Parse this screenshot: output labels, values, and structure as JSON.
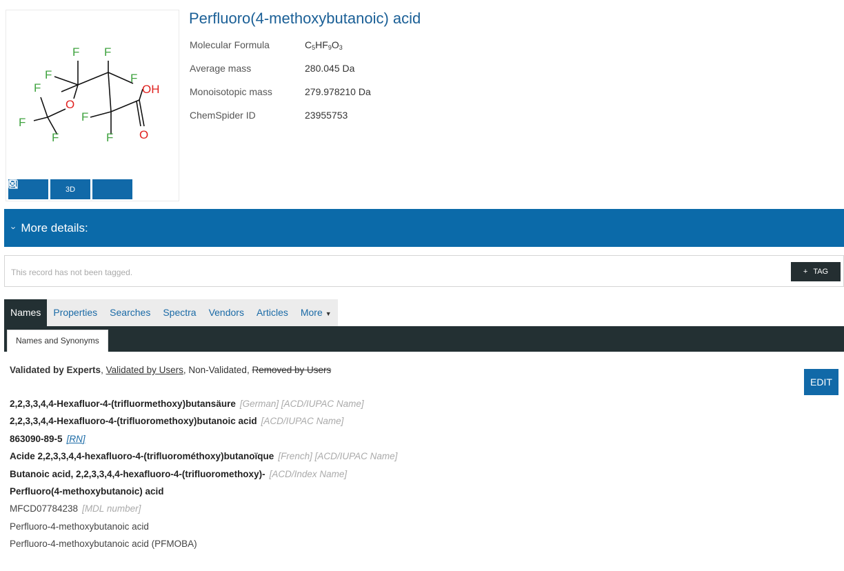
{
  "compound": {
    "title": "Perfluoro(4-methoxybutanoic) acid",
    "properties": [
      {
        "label": "Molecular Formula",
        "parts": [
          {
            "t": "C"
          },
          {
            "t": "5",
            "sub": true
          },
          {
            "t": "HF"
          },
          {
            "t": "9",
            "sub": true
          },
          {
            "t": "O"
          },
          {
            "t": "3",
            "sub": true
          }
        ]
      },
      {
        "label": "Average mass",
        "value": "280.045 Da"
      },
      {
        "label": "Monoisotopic mass",
        "value": "279.978210 Da"
      },
      {
        "label": "ChemSpider ID",
        "value": "23955753"
      }
    ]
  },
  "structure": {
    "atoms": [
      "F",
      "F",
      "F",
      "F",
      "F",
      "OH",
      "F",
      "O",
      "F",
      "F",
      "F",
      "O"
    ],
    "colors": {
      "fluorine": "#3fa33f",
      "oxygen": "#e0201e",
      "bond": "#111111"
    }
  },
  "image_toolbar": {
    "save_icon": "save-icon",
    "three_d_label": "3D",
    "zoom_icon": "zoom-in-icon"
  },
  "details": {
    "label": "More details:"
  },
  "tags": {
    "empty_text": "This record has not been tagged.",
    "button_plus": "+",
    "button_label": "TAG"
  },
  "tabs": [
    {
      "label": "Names",
      "active": true
    },
    {
      "label": "Properties"
    },
    {
      "label": "Searches"
    },
    {
      "label": "Spectra"
    },
    {
      "label": "Vendors"
    },
    {
      "label": "Articles"
    },
    {
      "label": "More"
    }
  ],
  "subtab": {
    "label": "Names and Synonyms"
  },
  "legend": {
    "experts": "Validated by Experts",
    "sep1": ", ",
    "users": "Validated by Users",
    "sep2": ", Non-Validated, ",
    "removed": "Removed by Users"
  },
  "edit_label": "EDIT",
  "names": [
    {
      "name": "2,2,3,3,4,4-Hexafluor-4-(trifluormethoxy)butansäure",
      "ref": "[German] [ACD/IUPAC Name]",
      "bold": true
    },
    {
      "name": "2,2,3,3,4,4-Hexafluoro-4-(trifluoromethoxy)butanoic acid",
      "ref": "[ACD/IUPAC Name]",
      "bold": true
    },
    {
      "name": "863090-89-5",
      "ref": "[RN]",
      "bold": true,
      "link": true
    },
    {
      "name": "Acide 2,2,3,3,4,4-hexafluoro-4-(trifluorométhoxy)butanoïque",
      "ref": "[French] [ACD/IUPAC Name]",
      "bold": true
    },
    {
      "name": "Butanoic acid, 2,2,3,3,4,4-hexafluoro-4-(trifluoromethoxy)-",
      "ref": "[ACD/Index Name]",
      "bold": true
    },
    {
      "name": "Perfluoro(4-methoxybutanoic) acid",
      "ref": "",
      "bold": true
    },
    {
      "name": "MFCD07784238",
      "ref": "[MDL number]",
      "bold": false
    },
    {
      "name": "Perfluoro-4-methoxybutanoic acid",
      "ref": "",
      "bold": false
    },
    {
      "name": "Perfluoro-4-methoxybutanoic acid (PFMOBA)",
      "ref": "",
      "bold": false
    }
  ]
}
